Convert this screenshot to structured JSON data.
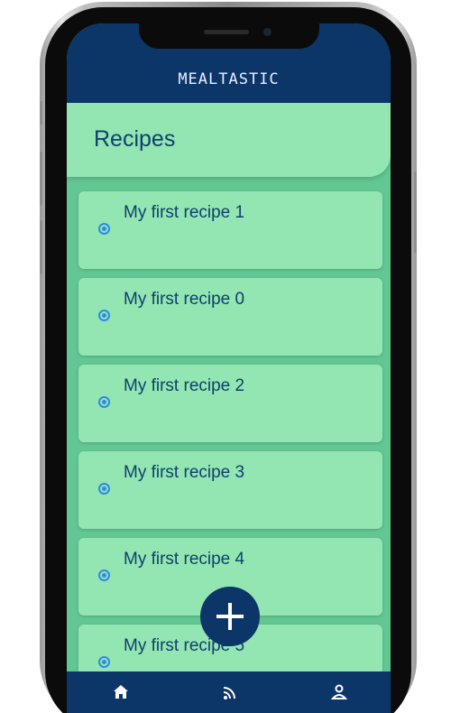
{
  "app": {
    "title": "MEALTASTIC"
  },
  "section": {
    "title": "Recipes"
  },
  "recipes": [
    {
      "label": "My first recipe 1"
    },
    {
      "label": "My first recipe 0"
    },
    {
      "label": "My first recipe 2"
    },
    {
      "label": "My first recipe 3"
    },
    {
      "label": "My first recipe 4"
    },
    {
      "label": "My first recipe 5"
    }
  ],
  "fab": {
    "icon": "plus-icon",
    "label": "+"
  },
  "bottom_nav": [
    {
      "icon": "home-icon"
    },
    {
      "icon": "rss-feed-icon"
    },
    {
      "icon": "user-icon"
    }
  ],
  "colors": {
    "primary": "#0c3568",
    "card": "#93e6b2",
    "background": "#62c792",
    "text": "#0f3f6e",
    "radio": "#2e8ae6"
  }
}
